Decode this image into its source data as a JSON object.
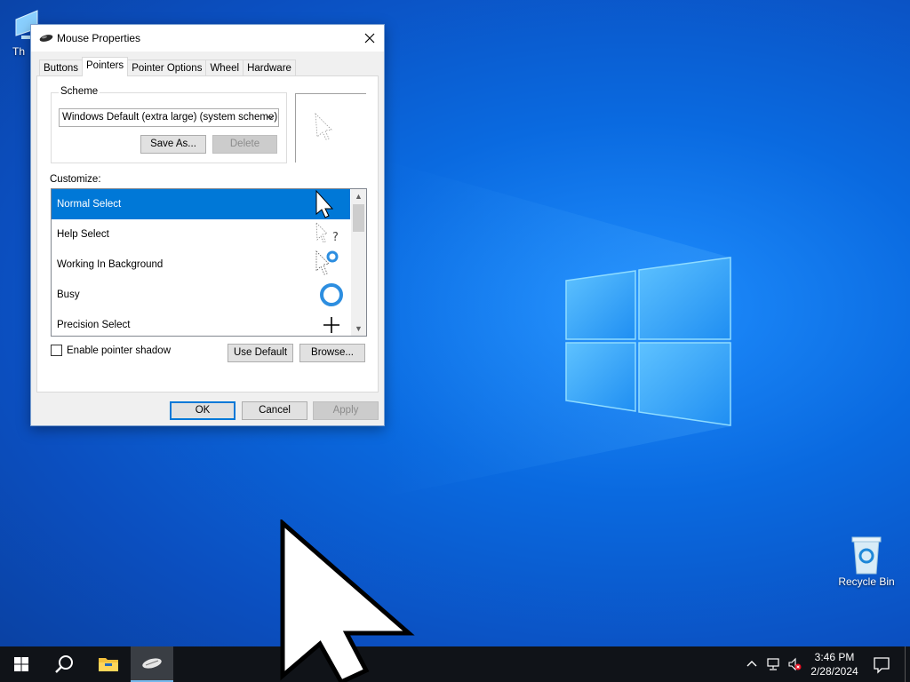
{
  "desktop": {
    "icons": [
      {
        "label": "Th",
        "icon": "this-pc-icon"
      },
      {
        "label": "Recycle Bin",
        "icon": "recycle-bin-icon"
      }
    ]
  },
  "dialog": {
    "title": "Mouse Properties",
    "tabs": [
      {
        "label": "Buttons",
        "active": false
      },
      {
        "label": "Pointers",
        "active": true
      },
      {
        "label": "Pointer Options",
        "active": false
      },
      {
        "label": "Wheel",
        "active": false
      },
      {
        "label": "Hardware",
        "active": false
      }
    ],
    "scheme": {
      "legend": "Scheme",
      "selected": "Windows Default (extra large) (system scheme)",
      "save_as": "Save As...",
      "delete": "Delete"
    },
    "customize": {
      "label": "Customize:",
      "items": [
        {
          "label": "Normal Select",
          "icon": "arrow-cursor-icon",
          "selected": true
        },
        {
          "label": "Help Select",
          "icon": "help-cursor-icon",
          "selected": false
        },
        {
          "label": "Working In Background",
          "icon": "working-cursor-icon",
          "selected": false
        },
        {
          "label": "Busy",
          "icon": "busy-ring-icon",
          "selected": false
        },
        {
          "label": "Precision Select",
          "icon": "crosshair-icon",
          "selected": false
        }
      ]
    },
    "enable_shadow": {
      "label": "Enable pointer shadow",
      "checked": false
    },
    "use_default": "Use Default",
    "browse": "Browse...",
    "buttons": {
      "ok": "OK",
      "cancel": "Cancel",
      "apply": "Apply"
    }
  },
  "taskbar": {
    "time": "3:46 PM",
    "date": "2/28/2024"
  },
  "colors": {
    "accent": "#0078d7",
    "taskbar": "#101318",
    "busy_ring": "#2d8ee0"
  }
}
